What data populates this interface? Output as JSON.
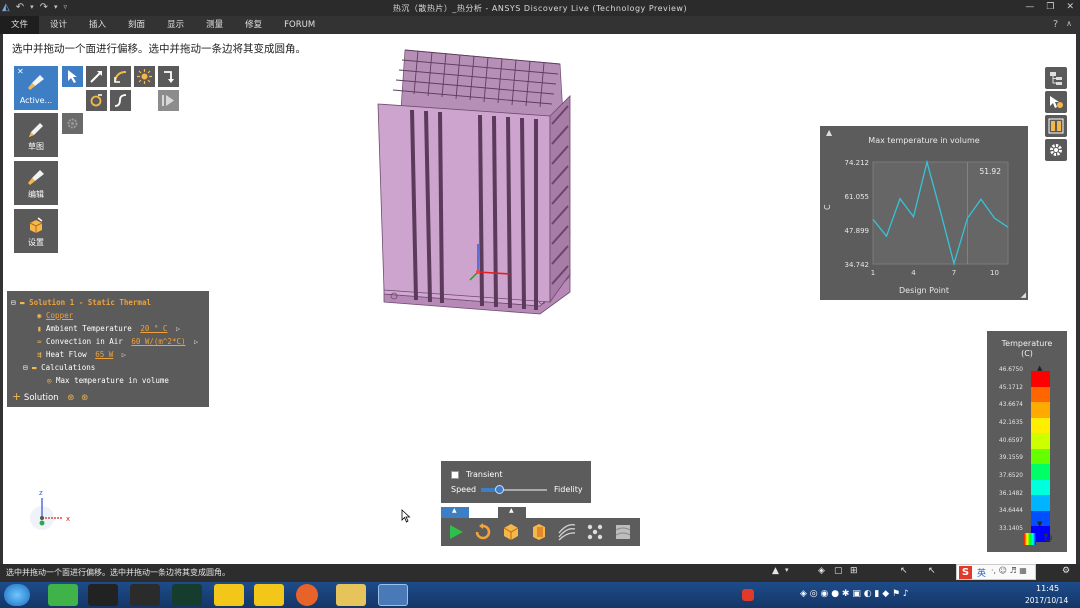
{
  "window": {
    "title": "热沉（散热片）_热分析 - ANSYS Discovery Live (Technology Preview)"
  },
  "menu": {
    "items": [
      "文件",
      "设计",
      "插入",
      "刻面",
      "显示",
      "测量",
      "修复",
      "FORUM"
    ]
  },
  "hint_text": "选中并拖动一个面进行偏移。选中并拖动一条边将其变成圆角。",
  "tools": {
    "active_label": "Active...",
    "sketch_label": "草图",
    "edit_label": "编辑",
    "setup_label": "设置"
  },
  "tree": {
    "solution_title": "Solution 1 - Static Thermal",
    "material": "Copper",
    "ambient_label": "Ambient Temperature",
    "ambient_value": "20 ° C",
    "convection_label": "Convection in Air",
    "convection_value": "60 W/(m^2*C)",
    "heatflow_label": "Heat Flow",
    "heatflow_value": "65 W",
    "calculations_label": "Calculations",
    "calc_item": "Max temperature in volume",
    "add_solution": "Solution"
  },
  "chart_data": {
    "type": "line",
    "title": "Max temperature in volume",
    "xlabel": "Design Point",
    "ylabel": "C",
    "x": [
      1,
      2,
      3,
      4,
      5,
      6,
      7,
      8,
      9,
      10,
      11
    ],
    "values": [
      52.0,
      45.5,
      60.0,
      53.0,
      74.2,
      55.0,
      34.9,
      52.5,
      59.8,
      52.5,
      49.0
    ],
    "xticks": [
      "1",
      "4",
      "7",
      "10"
    ],
    "yticks": [
      "74.212",
      "61.055",
      "47.899",
      "34.742"
    ],
    "ylim": [
      34.742,
      74.212
    ],
    "xlim": [
      1,
      11
    ],
    "marker_x": 8,
    "marker_label": "51.92",
    "line_color": "#35c4d8"
  },
  "legend": {
    "title": "Temperature",
    "unit": "(C)",
    "labels": [
      "46.6750",
      "45.1712",
      "43.6674",
      "42.1635",
      "40.6597",
      "39.1559",
      "37.6520",
      "36.1482",
      "34.6444",
      "33.1405"
    ],
    "colors": [
      "#ff0000",
      "#ff6600",
      "#ffaa00",
      "#ffee00",
      "#ccff00",
      "#66ff00",
      "#00ff66",
      "#00ffdd",
      "#00b4ff",
      "#0050ff",
      "#0000ff"
    ]
  },
  "transient": {
    "checkbox_label": "Transient",
    "speed_label": "Speed",
    "fidelity_label": "Fidelity"
  },
  "triad": {
    "z": "z",
    "x": "x"
  },
  "statusbar": {
    "text": "选中并拖动一个面进行偏移。选中并拖动一条边将其变成圆角。"
  },
  "taskbar": {
    "ime": "英",
    "time": "11:45",
    "date": "2017/10/14"
  }
}
